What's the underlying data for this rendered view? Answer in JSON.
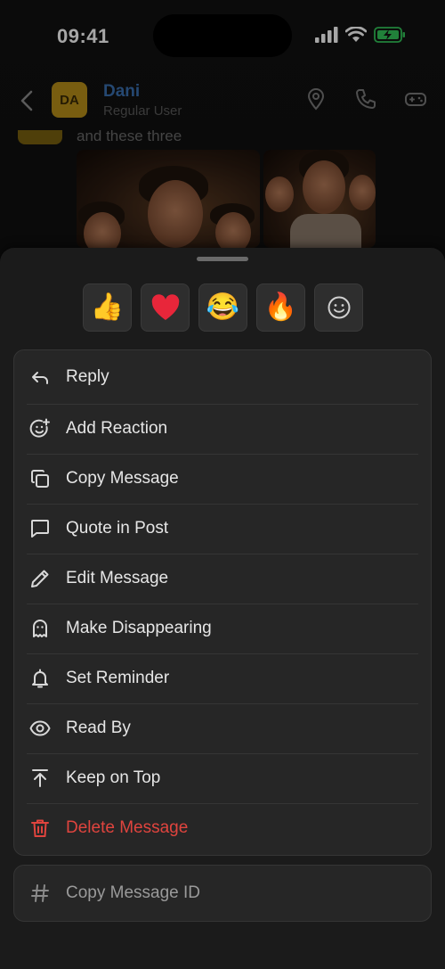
{
  "status_bar": {
    "time": "09:41"
  },
  "header": {
    "avatar_initials": "DA",
    "name": "Dani",
    "subtitle": "Regular User",
    "icons": [
      "location-pin-icon",
      "phone-icon",
      "gamepad-icon"
    ]
  },
  "chat": {
    "last_message_text": "and these three"
  },
  "reactions": [
    {
      "emoji": "👍",
      "name": "thumbs-up"
    },
    {
      "emoji": "❤️",
      "name": "heart"
    },
    {
      "emoji": "😂",
      "name": "laughing"
    },
    {
      "emoji": "🔥",
      "name": "fire"
    },
    {
      "emoji": "☺",
      "name": "more-reactions"
    }
  ],
  "menu": [
    {
      "label": "Reply",
      "icon": "reply-icon"
    },
    {
      "label": "Add Reaction",
      "icon": "add-reaction-icon"
    },
    {
      "label": "Copy Message",
      "icon": "copy-icon"
    },
    {
      "label": "Quote in Post",
      "icon": "quote-icon"
    },
    {
      "label": "Edit Message",
      "icon": "pencil-icon"
    },
    {
      "label": "Make Disappearing",
      "icon": "ghost-icon"
    },
    {
      "label": "Set Reminder",
      "icon": "bell-icon"
    },
    {
      "label": "Read By",
      "icon": "eye-icon"
    },
    {
      "label": "Keep on Top",
      "icon": "pin-top-icon"
    },
    {
      "label": "Delete Message",
      "icon": "trash-icon",
      "danger": true
    }
  ],
  "secondary_menu": {
    "label": "Copy Message ID",
    "icon": "hash-icon"
  },
  "colors": {
    "danger": "#e0443e",
    "accent_name": "#3a6fb0",
    "avatar_bg": "#b8901a",
    "battery_green": "#34c759"
  }
}
